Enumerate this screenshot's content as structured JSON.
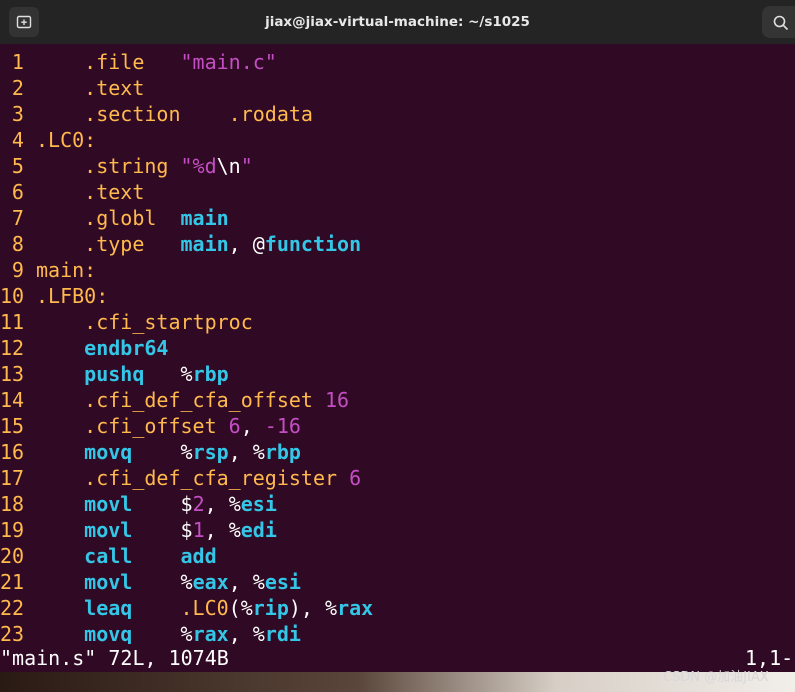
{
  "window": {
    "title": "jiax@jiax-virtual-machine: ~/s1025"
  },
  "icons": {
    "new_tab": "new-tab-icon",
    "search": "search-icon"
  },
  "colors": {
    "background": "#300a24",
    "orange": "#ffb94d",
    "cyan": "#34c6e6",
    "magenta": "#c44ec4",
    "white": "#ffffff",
    "titlebar": "#242424"
  },
  "editor": {
    "lines": [
      {
        "n": "1",
        "segs": [
          {
            "t": "    .file   ",
            "c": "dir"
          },
          {
            "t": "\"main.c\"",
            "c": "str"
          }
        ]
      },
      {
        "n": "2",
        "segs": [
          {
            "t": "    .text",
            "c": "dir"
          }
        ]
      },
      {
        "n": "3",
        "segs": [
          {
            "t": "    .section    .rodata",
            "c": "dir"
          }
        ]
      },
      {
        "n": "4",
        "segs": [
          {
            "t": ".LC0:",
            "c": "label"
          }
        ]
      },
      {
        "n": "5",
        "segs": [
          {
            "t": "    .string ",
            "c": "dir"
          },
          {
            "t": "\"%d",
            "c": "str"
          },
          {
            "t": "\\n",
            "c": "plain"
          },
          {
            "t": "\"",
            "c": "str"
          }
        ]
      },
      {
        "n": "6",
        "segs": [
          {
            "t": "    .text",
            "c": "dir"
          }
        ]
      },
      {
        "n": "7",
        "segs": [
          {
            "t": "    .globl  ",
            "c": "dir"
          },
          {
            "t": "main",
            "c": "sym"
          }
        ]
      },
      {
        "n": "8",
        "segs": [
          {
            "t": "    .type   ",
            "c": "dir"
          },
          {
            "t": "main",
            "c": "sym"
          },
          {
            "t": ", @",
            "c": "plain"
          },
          {
            "t": "function",
            "c": "sym"
          }
        ]
      },
      {
        "n": "9",
        "segs": [
          {
            "t": "main:",
            "c": "label"
          }
        ]
      },
      {
        "n": "10",
        "segs": [
          {
            "t": ".LFB0:",
            "c": "label"
          }
        ]
      },
      {
        "n": "11",
        "segs": [
          {
            "t": "    .cfi_startproc",
            "c": "dir"
          }
        ]
      },
      {
        "n": "12",
        "segs": [
          {
            "t": "    ",
            "c": "plain"
          },
          {
            "t": "endbr64",
            "c": "instr"
          }
        ]
      },
      {
        "n": "13",
        "segs": [
          {
            "t": "    ",
            "c": "plain"
          },
          {
            "t": "pushq",
            "c": "instr"
          },
          {
            "t": "   %",
            "c": "plain"
          },
          {
            "t": "rbp",
            "c": "reg"
          }
        ]
      },
      {
        "n": "14",
        "segs": [
          {
            "t": "    .cfi_def_cfa_offset ",
            "c": "dir"
          },
          {
            "t": "16",
            "c": "num"
          }
        ]
      },
      {
        "n": "15",
        "segs": [
          {
            "t": "    .cfi_offset ",
            "c": "dir"
          },
          {
            "t": "6",
            "c": "num"
          },
          {
            "t": ", ",
            "c": "plain"
          },
          {
            "t": "-16",
            "c": "num"
          }
        ]
      },
      {
        "n": "16",
        "segs": [
          {
            "t": "    ",
            "c": "plain"
          },
          {
            "t": "movq",
            "c": "instr"
          },
          {
            "t": "    %",
            "c": "plain"
          },
          {
            "t": "rsp",
            "c": "reg"
          },
          {
            "t": ", %",
            "c": "plain"
          },
          {
            "t": "rbp",
            "c": "reg"
          }
        ]
      },
      {
        "n": "17",
        "segs": [
          {
            "t": "    .cfi_def_cfa_register ",
            "c": "dir"
          },
          {
            "t": "6",
            "c": "num"
          }
        ]
      },
      {
        "n": "18",
        "segs": [
          {
            "t": "    ",
            "c": "plain"
          },
          {
            "t": "movl",
            "c": "instr"
          },
          {
            "t": "    $",
            "c": "plain"
          },
          {
            "t": "2",
            "c": "num"
          },
          {
            "t": ", %",
            "c": "plain"
          },
          {
            "t": "esi",
            "c": "reg"
          }
        ]
      },
      {
        "n": "19",
        "segs": [
          {
            "t": "    ",
            "c": "plain"
          },
          {
            "t": "movl",
            "c": "instr"
          },
          {
            "t": "    $",
            "c": "plain"
          },
          {
            "t": "1",
            "c": "num"
          },
          {
            "t": ", %",
            "c": "plain"
          },
          {
            "t": "edi",
            "c": "reg"
          }
        ]
      },
      {
        "n": "20",
        "segs": [
          {
            "t": "    ",
            "c": "plain"
          },
          {
            "t": "call",
            "c": "instr"
          },
          {
            "t": "    ",
            "c": "plain"
          },
          {
            "t": "add",
            "c": "sym"
          }
        ]
      },
      {
        "n": "21",
        "segs": [
          {
            "t": "    ",
            "c": "plain"
          },
          {
            "t": "movl",
            "c": "instr"
          },
          {
            "t": "    %",
            "c": "plain"
          },
          {
            "t": "eax",
            "c": "reg"
          },
          {
            "t": ", %",
            "c": "plain"
          },
          {
            "t": "esi",
            "c": "reg"
          }
        ]
      },
      {
        "n": "22",
        "segs": [
          {
            "t": "    ",
            "c": "plain"
          },
          {
            "t": "leaq",
            "c": "instr"
          },
          {
            "t": "    .LC0",
            "c": "dir"
          },
          {
            "t": "(%",
            "c": "plain"
          },
          {
            "t": "rip",
            "c": "reg"
          },
          {
            "t": "), %",
            "c": "plain"
          },
          {
            "t": "rax",
            "c": "reg"
          }
        ]
      },
      {
        "n": "23",
        "segs": [
          {
            "t": "    ",
            "c": "plain"
          },
          {
            "t": "movq",
            "c": "instr"
          },
          {
            "t": "    %",
            "c": "plain"
          },
          {
            "t": "rax",
            "c": "reg"
          },
          {
            "t": ", %",
            "c": "plain"
          },
          {
            "t": "rdi",
            "c": "reg"
          }
        ]
      }
    ]
  },
  "status_bar": {
    "file_info": "\"main.s\" 72L, 1074B",
    "cursor": "1,1-"
  },
  "watermark": "CSDN @加油JIAX"
}
